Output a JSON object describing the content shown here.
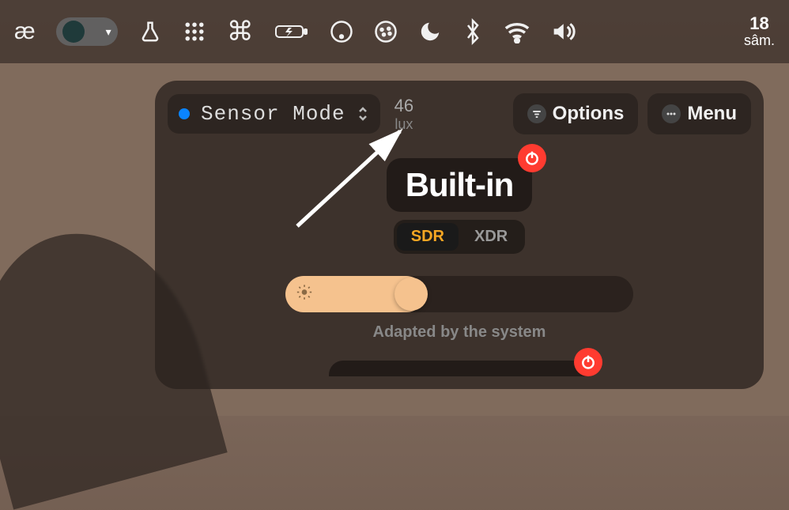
{
  "menubar": {
    "items": [
      "ae-icon",
      "toggle",
      "flask-icon",
      "grid-dots-icon",
      "command-icon",
      "battery-charging-icon",
      "circle-icon",
      "cookie-icon",
      "moon-icon",
      "bluetooth-icon",
      "wifi-icon",
      "volume-icon"
    ],
    "date_day": "18",
    "date_label": "sâm."
  },
  "panel": {
    "mode": {
      "label": "Sensor Mode",
      "indicator": "#0a84ff"
    },
    "lux": {
      "value": "46",
      "label": "lux"
    },
    "options_label": "Options",
    "menu_label": "Menu",
    "display": {
      "name": "Built-in",
      "range_options": [
        "SDR",
        "XDR"
      ],
      "range_active": "SDR",
      "brightness_percent": 40,
      "caption": "Adapted by the system"
    }
  }
}
